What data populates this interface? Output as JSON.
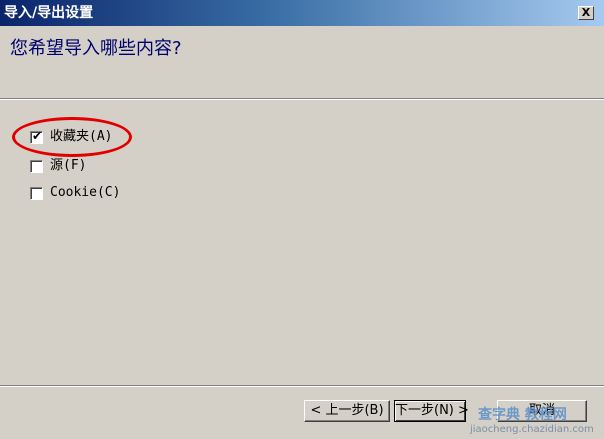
{
  "window": {
    "title": "导入/导出设置",
    "close_glyph": "X"
  },
  "header": {
    "question": "您希望导入哪些内容?"
  },
  "options": [
    {
      "label": "收藏夹(A)",
      "checked": true
    },
    {
      "label": "源(F)",
      "checked": false
    },
    {
      "label": "Cookie(C)",
      "checked": false
    }
  ],
  "buttons": {
    "back": "< 上一步(B)",
    "next": "下一步(N) >",
    "cancel": "取消"
  },
  "watermark": {
    "brand": "查字典 教程网",
    "url": "jiaocheng.chazidian.com"
  },
  "colors": {
    "title_bar_start": "#0a246a",
    "question_text": "#00006b",
    "highlight_circle": "#e00000",
    "dialog_bg": "#d4d0c8"
  },
  "icons": {
    "check": "check-mark-icon",
    "close": "close-icon"
  }
}
